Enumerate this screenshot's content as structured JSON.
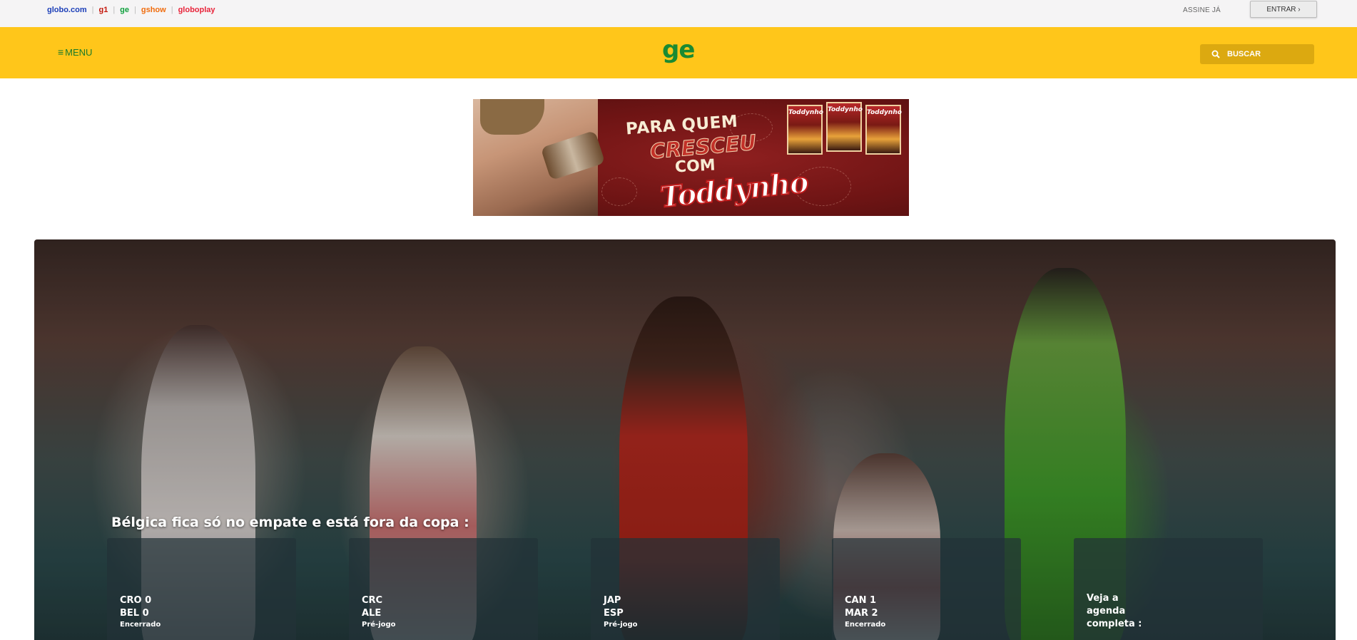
{
  "globo_bar": {
    "links": [
      {
        "label": "globo.com",
        "color": "#1b3eb8"
      },
      {
        "label": "g1",
        "color": "#c4170c"
      },
      {
        "label": "ge",
        "color": "#0fa03d"
      },
      {
        "label": "gshow",
        "color": "#f06c0d"
      },
      {
        "label": "globoplay",
        "color": "#e8243a"
      }
    ],
    "assine": "ASSINE JÁ",
    "entrar": "ENTRAR ›"
  },
  "header": {
    "menu_label": "MENU",
    "logo": "ge",
    "search_label": "BUSCAR",
    "bg_color": "#ffc61a",
    "accent_color": "#1a8a32"
  },
  "ad": {
    "line1": "PARA QUEM",
    "line2": "CRESCEU",
    "line3": "COM",
    "brand": "Toddynho",
    "box_label": "Toddynho"
  },
  "hero": {
    "title": "Bélgica fica só no empate e está fora da copa :",
    "cards": [
      {
        "team1": "CRO 0",
        "team2": "BEL 0",
        "status": "Encerrado"
      },
      {
        "team1": "CRC",
        "team2": "ALE",
        "status": "Pré-jogo"
      },
      {
        "team1": "JAP",
        "team2": "ESP",
        "status": "Pré-jogo"
      },
      {
        "team1": "CAN 1",
        "team2": "MAR 2",
        "status": "Encerrado"
      }
    ],
    "agenda": "Veja a agenda completa :"
  }
}
